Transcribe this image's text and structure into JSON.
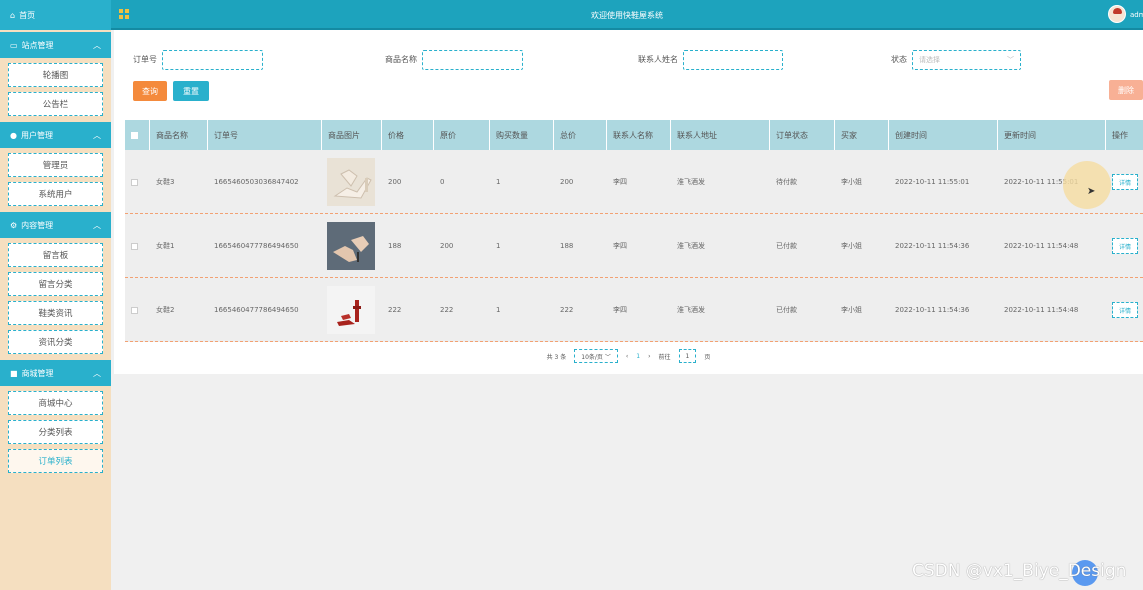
{
  "sidebar": {
    "home": "首页",
    "groups": [
      {
        "label": "站点管理",
        "items": [
          "轮播图",
          "公告栏"
        ]
      },
      {
        "label": "用户管理",
        "items": [
          "管理员",
          "系统用户"
        ]
      },
      {
        "label": "内容管理",
        "items": [
          "留言板",
          "留言分类",
          "鞋类资讯",
          "资讯分类"
        ]
      },
      {
        "label": "商城管理",
        "items": [
          "商城中心",
          "分类列表",
          "订单列表"
        ]
      }
    ],
    "active_item": "订单列表"
  },
  "topbar": {
    "title": "欢迎使用快鞋屋系统",
    "user": "adm"
  },
  "filters": {
    "order_no_label": "订单号",
    "product_name_label": "商品名称",
    "contact_name_label": "联系人姓名",
    "status_label": "状态",
    "status_placeholder": "请选择",
    "search_btn": "查询",
    "reset_btn": "重置",
    "delete_btn": "删除"
  },
  "table": {
    "headers": [
      "商品名称",
      "订单号",
      "商品图片",
      "价格",
      "原价",
      "购买数量",
      "总价",
      "联系人名称",
      "联系人地址",
      "订单状态",
      "买家",
      "创建时间",
      "更新时间",
      "操作"
    ],
    "rows": [
      {
        "name": "女鞋3",
        "order_no": "1665460503036847402",
        "price": "200",
        "orig_price": "0",
        "qty": "1",
        "total": "200",
        "contact": "李四",
        "address": "淮飞酒发",
        "status": "待付款",
        "buyer": "李小姐",
        "created": "2022-10-11 11:55:01",
        "updated": "2022-10-11 11:55:01",
        "action": "详情",
        "image": "white-heel"
      },
      {
        "name": "女鞋1",
        "order_no": "1665460477786494650",
        "price": "188",
        "orig_price": "200",
        "qty": "1",
        "total": "188",
        "contact": "李四",
        "address": "淮飞酒发",
        "status": "已付款",
        "buyer": "李小姐",
        "created": "2022-10-11 11:54:36",
        "updated": "2022-10-11 11:54:48",
        "action": "详情",
        "image": "nude-heel"
      },
      {
        "name": "女鞋2",
        "order_no": "1665460477786494650",
        "price": "222",
        "orig_price": "222",
        "qty": "1",
        "total": "222",
        "contact": "李四",
        "address": "淮飞酒发",
        "status": "已付款",
        "buyer": "李小姐",
        "created": "2022-10-11 11:54:36",
        "updated": "2022-10-11 11:54:48",
        "action": "详情",
        "image": "red-sandal"
      }
    ]
  },
  "pager": {
    "total": "共 3 条",
    "page_size": "10条/页",
    "current_page": "1",
    "goto_prefix": "前往",
    "goto_value": "1",
    "goto_suffix": "页"
  },
  "watermark": "CSDN @vx1_Biye_Design"
}
